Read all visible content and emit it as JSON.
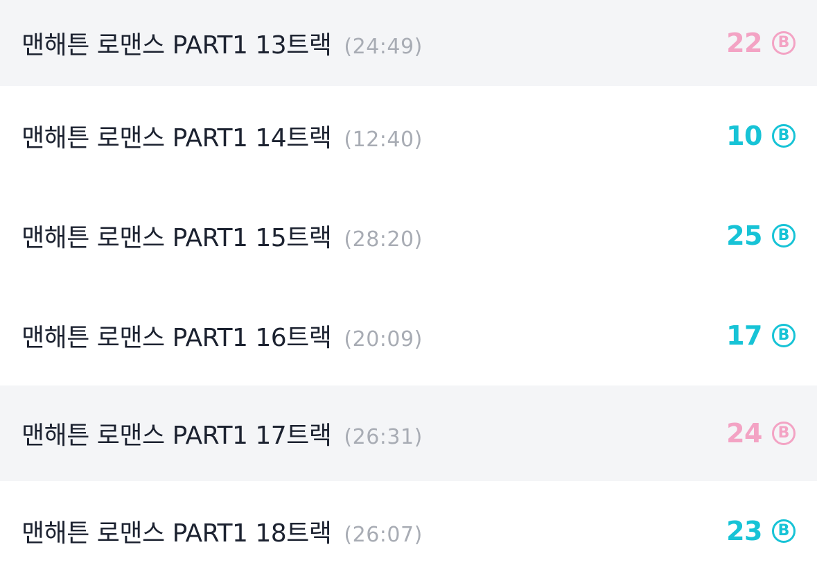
{
  "tracks": [
    {
      "title": "맨해튼 로맨스 PART1 13트랙",
      "duration": "(24:49)",
      "price": "22",
      "coin_symbol": "B",
      "purchased": true
    },
    {
      "title": "맨해튼 로맨스 PART1 14트랙",
      "duration": "(12:40)",
      "price": "10",
      "coin_symbol": "B",
      "purchased": false
    },
    {
      "title": "맨해튼 로맨스 PART1 15트랙",
      "duration": "(28:20)",
      "price": "25",
      "coin_symbol": "B",
      "purchased": false
    },
    {
      "title": "맨해튼 로맨스 PART1 16트랙",
      "duration": "(20:09)",
      "price": "17",
      "coin_symbol": "B",
      "purchased": false
    },
    {
      "title": "맨해튼 로맨스 PART1 17트랙",
      "duration": "(26:31)",
      "price": "24",
      "coin_symbol": "B",
      "purchased": true
    },
    {
      "title": "맨해튼 로맨스 PART1 18트랙",
      "duration": "(26:07)",
      "price": "23",
      "coin_symbol": "B",
      "purchased": false
    }
  ],
  "colors": {
    "price_available": "#17c3d6",
    "price_purchased": "#f3a3c4",
    "row_purchased_bg": "#f4f5f7",
    "title": "#1c2230",
    "duration": "#a8acb4"
  },
  "icons": {
    "coin": "coin-b-icon"
  }
}
